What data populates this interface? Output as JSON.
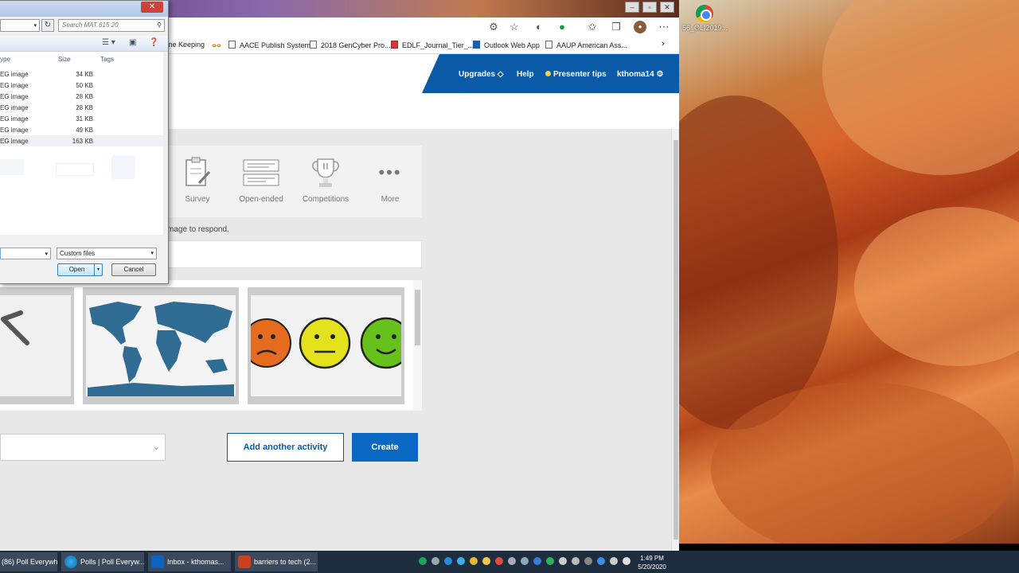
{
  "dialog": {
    "search_placeholder": "Search MAT 615 20",
    "columns": {
      "type": "ype",
      "size": "Size",
      "tags": "Tags"
    },
    "files": [
      {
        "type": "EG image",
        "size": "34 KB"
      },
      {
        "type": "EG image",
        "size": "50 KB"
      },
      {
        "type": "EG image",
        "size": "28 KB"
      },
      {
        "type": "EG image",
        "size": "28 KB"
      },
      {
        "type": "EG image",
        "size": "31 KB"
      },
      {
        "type": "EG image",
        "size": "49 KB"
      },
      {
        "type": "EG image",
        "size": "163 KB"
      }
    ],
    "filter_value": "Custom files",
    "open_label": "Open",
    "cancel_label": "Cancel",
    "close_label": "✕"
  },
  "bookmarks": [
    {
      "label": "me Keeping"
    },
    {
      "label": "AACE Publish System"
    },
    {
      "label": "2018 GenCyber Pro..."
    },
    {
      "label": "EDLF_Journal_Tier_..."
    },
    {
      "label": "Outlook Web App"
    },
    {
      "label": "AAUP American Ass..."
    }
  ],
  "nav": {
    "upgrades": "Upgrades",
    "help": "Help",
    "presenter_tips": "Presenter tips",
    "user": "kthoma14"
  },
  "activities": [
    {
      "label": "Survey"
    },
    {
      "label": "Open-ended"
    },
    {
      "label": "Competitions"
    },
    {
      "label": "More"
    }
  ],
  "hint_text": "mage to respond.",
  "buttons": {
    "add_activity": "Add another activity",
    "create": "Create"
  },
  "select_value": "",
  "desktop_icon": {
    "label": "56_OLI2019..."
  },
  "taskbar": {
    "tasks": [
      {
        "label": "(86) Poll Everywh..."
      },
      {
        "label": "Polls | Poll Everyw..."
      },
      {
        "label": "Inbox - kthomas..."
      },
      {
        "label": "barriers to tech (2..."
      }
    ],
    "time": "1:49 PM",
    "date": "5/20/2020"
  },
  "colors": {
    "brand_blue": "#0a5aa8",
    "create_blue": "#0a67c2",
    "map_blue": "#2f6b93"
  }
}
